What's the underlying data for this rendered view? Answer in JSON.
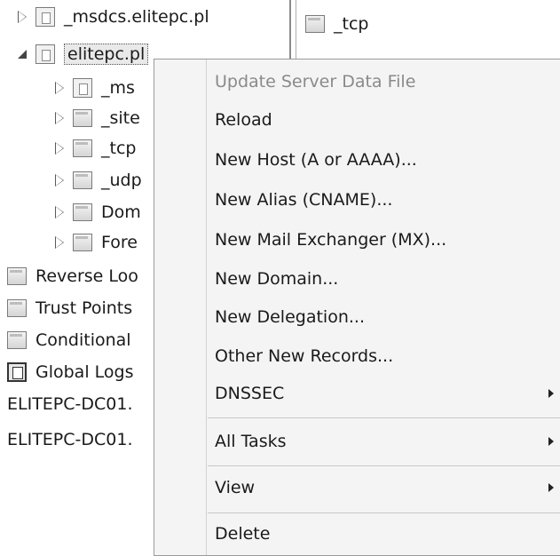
{
  "tree": {
    "items": [
      {
        "label": "_msdcs.elitepc.pl"
      },
      {
        "label": "elitepc.pl"
      },
      {
        "label": "_ms"
      },
      {
        "label": "_site"
      },
      {
        "label": "_tcp"
      },
      {
        "label": "_udp"
      },
      {
        "label": "Dom"
      },
      {
        "label": "Fore"
      },
      {
        "label": "Reverse Loo"
      },
      {
        "label": "Trust Points"
      },
      {
        "label": "Conditional"
      },
      {
        "label": "Global Logs"
      },
      {
        "label": "ELITEPC-DC01."
      },
      {
        "label": "ELITEPC-DC01."
      }
    ]
  },
  "right_pane": {
    "items": [
      {
        "label": "_tcp"
      }
    ]
  },
  "context_menu": {
    "items": [
      {
        "label": "Update Server Data File"
      },
      {
        "label": "Reload"
      },
      {
        "label": "New Host (A or AAAA)..."
      },
      {
        "label": "New Alias (CNAME)..."
      },
      {
        "label": "New Mail Exchanger (MX)..."
      },
      {
        "label": "New Domain..."
      },
      {
        "label": "New Delegation..."
      },
      {
        "label": "Other New Records..."
      },
      {
        "label": "DNSSEC"
      },
      {
        "label": "All Tasks"
      },
      {
        "label": "View"
      },
      {
        "label": "Delete"
      }
    ]
  },
  "icons": {
    "expander_collapsed": "triangle-right-icon",
    "expander_expanded": "triangle-down-icon",
    "folder": "folder-icon",
    "zone": "zone-file-icon",
    "log": "log-icon",
    "submenu": "chevron-right-icon"
  }
}
